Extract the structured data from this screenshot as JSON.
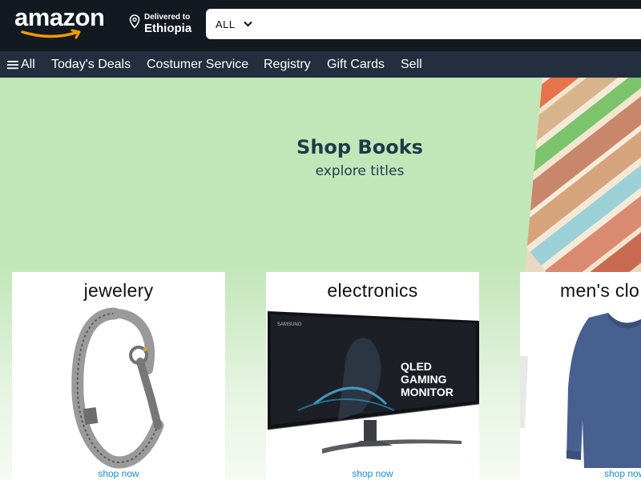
{
  "header": {
    "logo_text": "amazon",
    "deliver_line1": "Delivered to",
    "deliver_line2": "Ethiopia",
    "search": {
      "category": "ALL",
      "placeholder": "",
      "value": ""
    }
  },
  "nav": {
    "items": [
      {
        "label": "All",
        "name": "nav-all"
      },
      {
        "label": "Today's Deals",
        "name": "nav-todays-deals"
      },
      {
        "label": "Costumer Service",
        "name": "nav-costumer-service"
      },
      {
        "label": "Registry",
        "name": "nav-registry"
      },
      {
        "label": "Gift Cards",
        "name": "nav-gift-cards"
      },
      {
        "label": "Sell",
        "name": "nav-sell"
      }
    ]
  },
  "hero": {
    "title": "Shop Books",
    "subtitle": "explore titles"
  },
  "cards": [
    {
      "title": "jewelery",
      "link": "shop now",
      "image": "silver-bracelet"
    },
    {
      "title": "electronics",
      "link": "shop now",
      "image": "curved-monitor",
      "image_text": [
        "QLED",
        "GAMING",
        "MONITOR",
        "SAMSUNG"
      ]
    },
    {
      "title": "men's clo",
      "link": "shop now",
      "image": "blue-sweater"
    }
  ],
  "colors": {
    "header_bg": "#131921",
    "nav_bg": "#232f3e",
    "hero_bg": "#c1e6b8",
    "link": "#1b8ac9",
    "logo_arrow": "#f90"
  }
}
